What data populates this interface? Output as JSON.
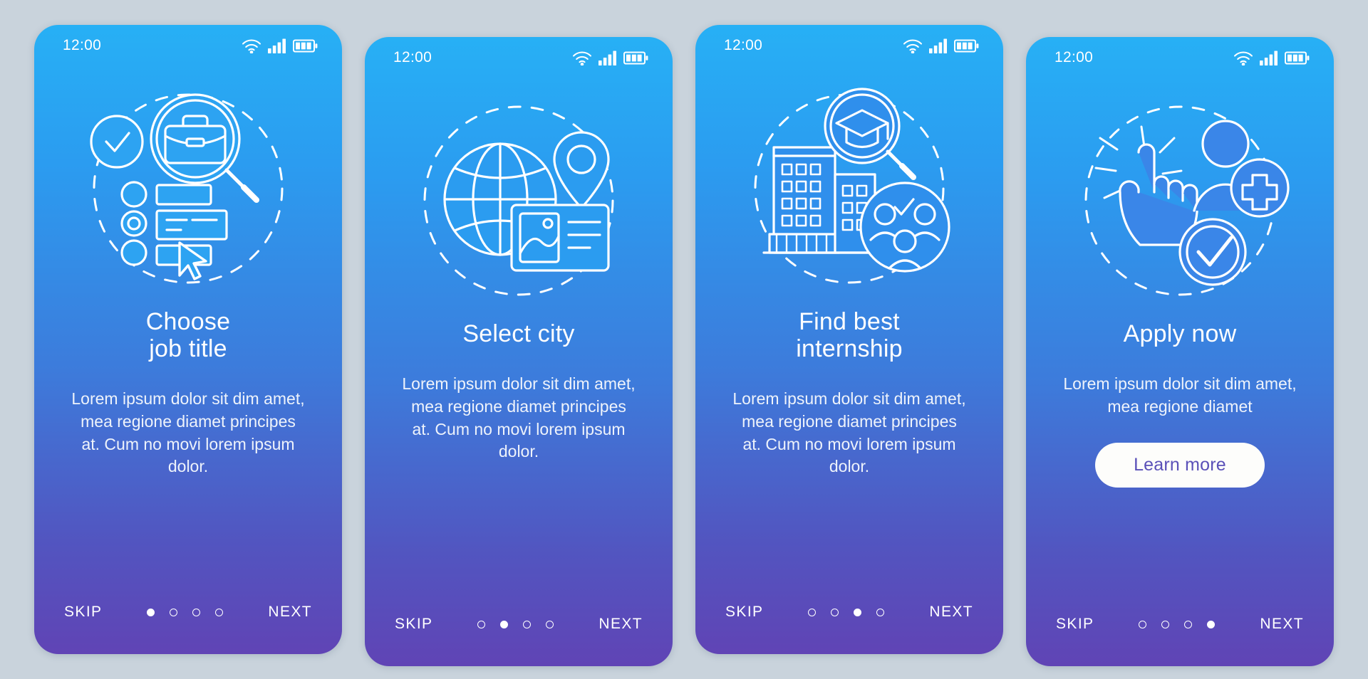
{
  "screens": [
    {
      "status": {
        "time": "12:00",
        "wifi_icon": "wifi-icon",
        "signal_icon": "cellular-signal-icon",
        "battery_icon": "battery-icon"
      },
      "illustration": "job-search-briefcase-magnifier-checklist-icon",
      "title": "Choose\njob title",
      "description": "Lorem ipsum dolor sit dim amet, mea regione diamet principes at. Cum no movi lorem ipsum dolor.",
      "skip_label": "SKIP",
      "next_label": "NEXT",
      "dots": 4,
      "active_dot": 1,
      "cta_label": null
    },
    {
      "status": {
        "time": "12:00",
        "wifi_icon": "wifi-icon",
        "signal_icon": "cellular-signal-icon",
        "battery_icon": "battery-icon"
      },
      "illustration": "globe-location-pin-id-card-icon",
      "title": "Select city",
      "description": "Lorem ipsum dolor sit dim amet, mea regione diamet principes at. Cum no movi lorem ipsum dolor.",
      "skip_label": "SKIP",
      "next_label": "NEXT",
      "dots": 4,
      "active_dot": 2,
      "cta_label": null
    },
    {
      "status": {
        "time": "12:00",
        "wifi_icon": "wifi-icon",
        "signal_icon": "cellular-signal-icon",
        "battery_icon": "battery-icon"
      },
      "illustration": "university-buildings-graduation-cap-magnifier-team-icon",
      "title": "Find best\ninternship",
      "description": "Lorem ipsum dolor sit dim amet, mea regione diamet principes at. Cum no movi lorem ipsum dolor.",
      "skip_label": "SKIP",
      "next_label": "NEXT",
      "dots": 4,
      "active_dot": 3,
      "cta_label": null
    },
    {
      "status": {
        "time": "12:00",
        "wifi_icon": "wifi-icon",
        "signal_icon": "cellular-signal-icon",
        "battery_icon": "battery-icon"
      },
      "illustration": "tap-hand-add-user-checkmark-icon",
      "title": "Apply now",
      "description": "Lorem ipsum dolor sit dim amet, mea regione diamet",
      "skip_label": "SKIP",
      "next_label": "NEXT",
      "dots": 4,
      "active_dot": 4,
      "cta_label": "Learn more"
    }
  ],
  "colors": {
    "page_background": "#c9d3dc",
    "gradient_top": "#27b0f5",
    "gradient_bottom": "#6044b5",
    "text": "#ffffff",
    "cta_background": "#fdfdfb",
    "cta_text": "#5a50b8"
  }
}
